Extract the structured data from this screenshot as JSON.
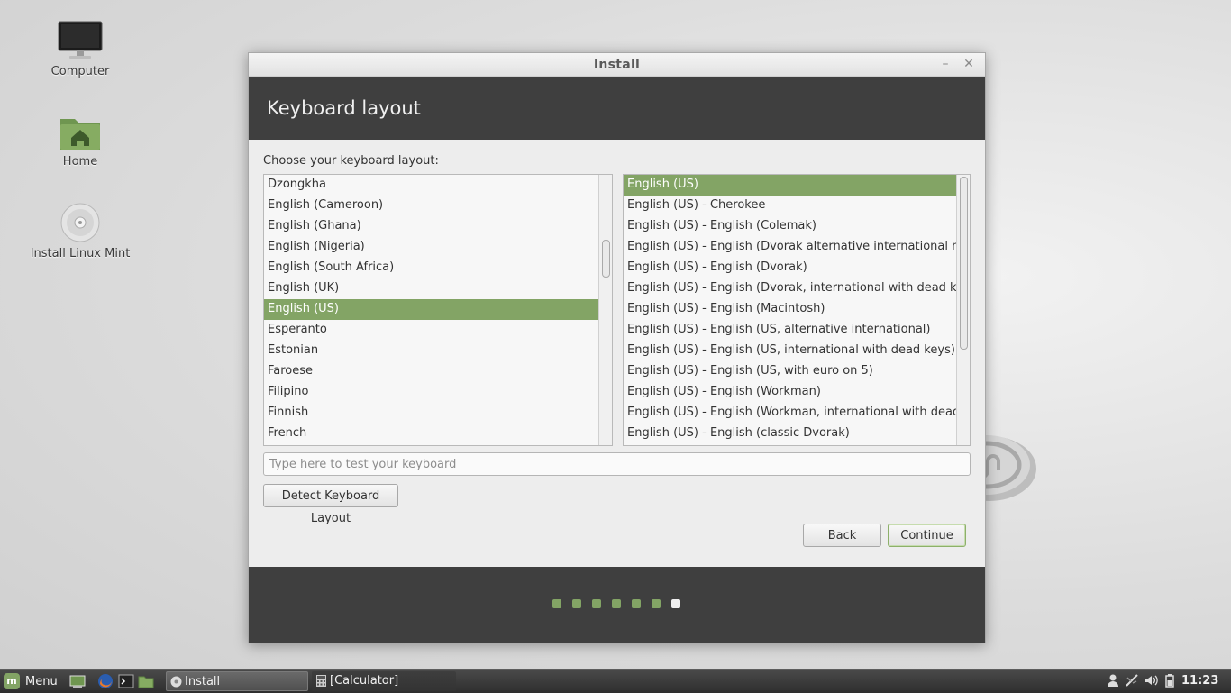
{
  "desktop": {
    "icons": [
      {
        "label": "Computer"
      },
      {
        "label": "Home"
      },
      {
        "label": "Install Linux Mint"
      }
    ]
  },
  "window": {
    "title": "Install",
    "heading": "Keyboard layout",
    "prompt": "Choose your keyboard layout:",
    "layouts": [
      "Dzongkha",
      "English (Cameroon)",
      "English (Ghana)",
      "English (Nigeria)",
      "English (South Africa)",
      "English (UK)",
      "English (US)",
      "Esperanto",
      "Estonian",
      "Faroese",
      "Filipino",
      "Finnish",
      "French"
    ],
    "layouts_selected": "English (US)",
    "variants": [
      "English (US)",
      "English (US) - Cherokee",
      "English (US) - English (Colemak)",
      "English (US) - English (Dvorak alternative international no dead ke",
      "English (US) - English (Dvorak)",
      "English (US) - English (Dvorak, international with dead keys)",
      "English (US) - English (Macintosh)",
      "English (US) - English (US, alternative international)",
      "English (US) - English (US, international with dead keys)",
      "English (US) - English (US, with euro on 5)",
      "English (US) - English (Workman)",
      "English (US) - English (Workman, international with dead keys)",
      "English (US) - English (classic Dvorak)"
    ],
    "variants_selected": "English (US)",
    "test_placeholder": "Type here to test your keyboard",
    "detect_label": "Detect Keyboard Layout",
    "back_label": "Back",
    "continue_label": "Continue",
    "progress": {
      "total_steps": 7,
      "current_step": 7
    },
    "accent_color": "#83a465"
  },
  "taskbar": {
    "menu_label": "Menu",
    "tasks": [
      {
        "label": "Install"
      },
      {
        "label": "[Calculator]"
      }
    ],
    "clock": "11:23"
  }
}
